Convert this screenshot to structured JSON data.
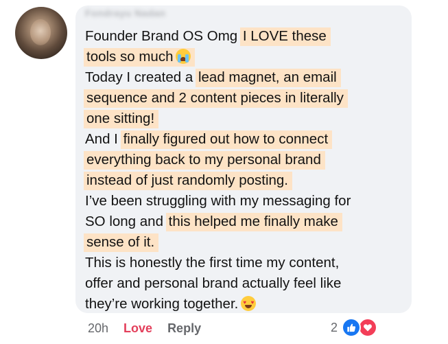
{
  "comment": {
    "author": "Fondrayu Nadan",
    "lines": [
      {
        "plain": "Founder Brand OS  Omg ",
        "hl": "I LOVE these"
      },
      {
        "plain": "",
        "hl": "tools so much"
      },
      {
        "plain": "Today I created a ",
        "hl": "lead magnet, an email"
      },
      {
        "plain": "",
        "hl": "sequence and 2 content pieces in literally"
      },
      {
        "plain": "",
        "hl": "one sitting!"
      },
      {
        "plain": "And I ",
        "hl": "finally figured out how to connect"
      },
      {
        "plain": "",
        "hl": "everything back to my personal brand"
      },
      {
        "plain": "",
        "hl": "instead of just randomly posting."
      },
      {
        "plain": "I’ve been struggling with my messaging for",
        "hl": ""
      },
      {
        "plain": "SO long and ",
        "hl": "this helped me finally make"
      },
      {
        "plain": "",
        "hl": "sense of it."
      },
      {
        "plain": "This is honestly the first time my content,",
        "hl": ""
      },
      {
        "plain": "offer and personal brand actually feel like",
        "hl": ""
      },
      {
        "plain": "they’re working together.",
        "hl": ""
      }
    ],
    "emojis": {
      "line2": "crying-face-emoji",
      "line14": "heart-eyes-emoji"
    }
  },
  "actions": {
    "time": "20h",
    "love": "Love",
    "reply": "Reply"
  },
  "reactions": {
    "count": "2",
    "icons": [
      "like-icon",
      "heart-icon"
    ]
  },
  "colors": {
    "highlight": "#fde3c6",
    "bubble": "#f0f2f5",
    "love": "#e33f5b",
    "like": "#1877f2",
    "heart": "#f33e58",
    "muted": "#65676b"
  }
}
